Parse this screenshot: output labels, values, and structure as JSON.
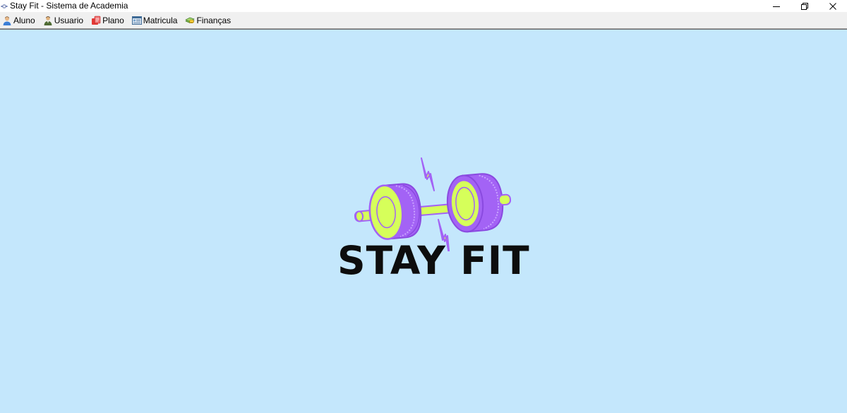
{
  "window": {
    "title": "Stay Fit - Sistema de Academia",
    "icon": "app-icon"
  },
  "controls": {
    "minimize": "minimize-icon",
    "restore": "restore-icon",
    "close": "close-icon"
  },
  "menu": {
    "items": [
      {
        "label": "Aluno",
        "icon": "student-icon"
      },
      {
        "label": "Usuario",
        "icon": "user-icon"
      },
      {
        "label": "Plano",
        "icon": "plan-icon"
      },
      {
        "label": "Matricula",
        "icon": "enrollment-icon"
      },
      {
        "label": "Finanças",
        "icon": "finance-icon"
      }
    ]
  },
  "logo": {
    "text": "STAY FIT",
    "colors": {
      "purple": "#a363f5",
      "lime": "#d6ff5a",
      "dark": "#0d0d0d",
      "background": "#c4e7fc"
    }
  }
}
